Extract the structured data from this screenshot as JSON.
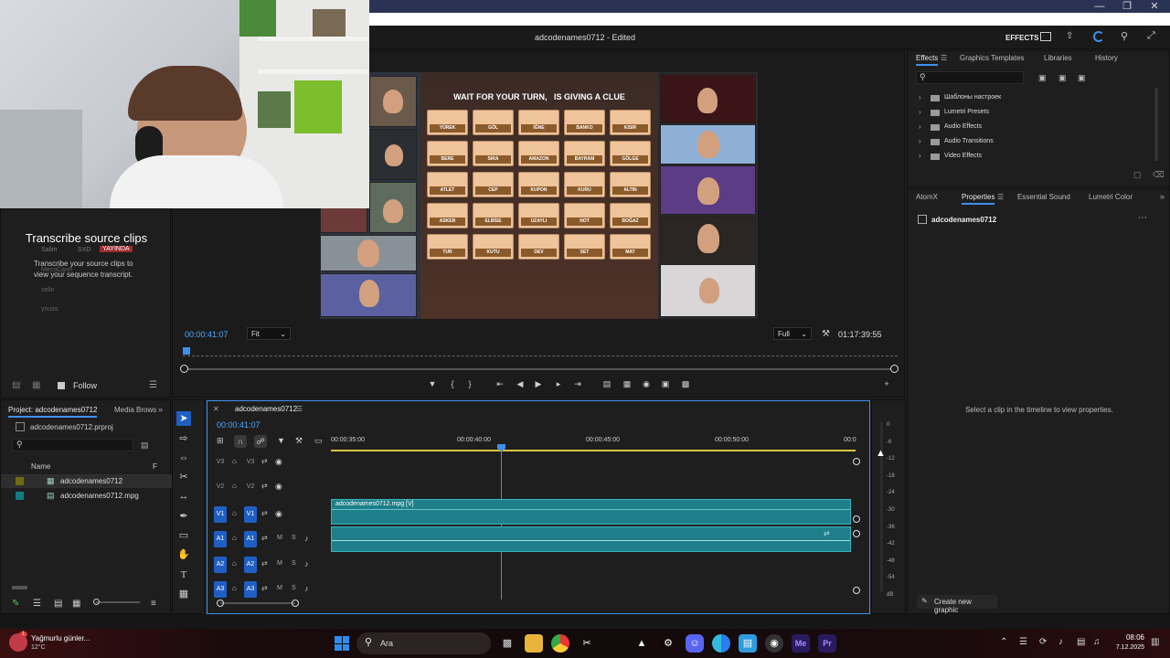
{
  "window": {
    "title": "adcodenames0712 - Edited",
    "workspace_label": "EFFECTS"
  },
  "webcam_overlay": {
    "heading": "Transcribe source clips",
    "subtext": "Transcribe your source clips to view your sequence transcript.",
    "chat_users": [
      "Salim",
      "SXD",
      "YAYINDA",
      "MecoCann",
      "selin",
      "ynuss"
    ]
  },
  "program_monitor": {
    "game_title": "WAIT FOR YOUR TURN,   IS GIVING A CLUE",
    "words": [
      [
        "YÜREK",
        "GÖL",
        "İĞNE",
        "BANKO",
        "KISIR"
      ],
      [
        "BERE",
        "SIRA",
        "AMAZON",
        "BAYRAM",
        "GÖLGE"
      ],
      [
        "ATLET",
        "CEP",
        "KUPON",
        "KURU",
        "ALTIN"
      ],
      [
        "ASKER",
        "ELBİSE",
        "UZAYLI",
        "NOT",
        "BOĞAZ"
      ],
      [
        "TUR",
        "KUTU",
        "DEV",
        "SET",
        "MAT"
      ]
    ],
    "timecode": "00:00:41:07",
    "fit_label": "Fit",
    "quality_label": "Full",
    "duration": "01:17:39:55",
    "follow_label": "Follow"
  },
  "effects_panel": {
    "tabs": [
      "Effects",
      "Graphics Templates",
      "Libraries",
      "History"
    ],
    "items": [
      "Шаблоны настроек",
      "Lumetri Presets",
      "Audio Effects",
      "Audio Transitions",
      "Video Effects"
    ]
  },
  "properties_panel": {
    "tabs": [
      "AtomX",
      "Properties",
      "Essential Sound",
      "Lumetri Color"
    ],
    "clip_name": "adcodenames0712",
    "hint": "Select a clip in the timeline to view properties.",
    "create_button": "Create new graphic"
  },
  "project_panel": {
    "tabs": [
      "Project: adcodenames0712",
      "Media Brows"
    ],
    "project_file": "adcodenames0712.prproj",
    "column_name": "Name",
    "column_f": "F",
    "items": [
      "adcodenames0712",
      "adcodenames0712.mpg"
    ]
  },
  "timeline": {
    "sequence_name": "adcodenames0712",
    "timecode": "00:00:41:07",
    "ruler": [
      "00:00:35:00",
      "00:00:40:00",
      "00:00:45:00",
      "00:00:50:00",
      "00:0"
    ],
    "video_tracks": [
      "V3",
      "V2",
      "V1"
    ],
    "audio_tracks": [
      "A1",
      "A2",
      "A3"
    ],
    "clip_label": "adcodenames0712.mpg [V]",
    "track_letters": [
      "M",
      "S"
    ],
    "meter_scale": [
      "0",
      "-6",
      "-12",
      "-18",
      "-24",
      "-30",
      "-36",
      "-42",
      "-48",
      "-54",
      "dB"
    ]
  },
  "taskbar": {
    "weather_title": "Yağmurlu günler...",
    "weather_temp": "12°C",
    "search_label": "Ara",
    "time": "08:06",
    "date": "7.12.2025",
    "notification_count": "1"
  },
  "colors": {
    "accent_blue": "#3f8ff0",
    "track_blue": "#1f5fc4",
    "clip_teal": "#1e7f8a",
    "ruler_yellow": "#d8c63a"
  }
}
